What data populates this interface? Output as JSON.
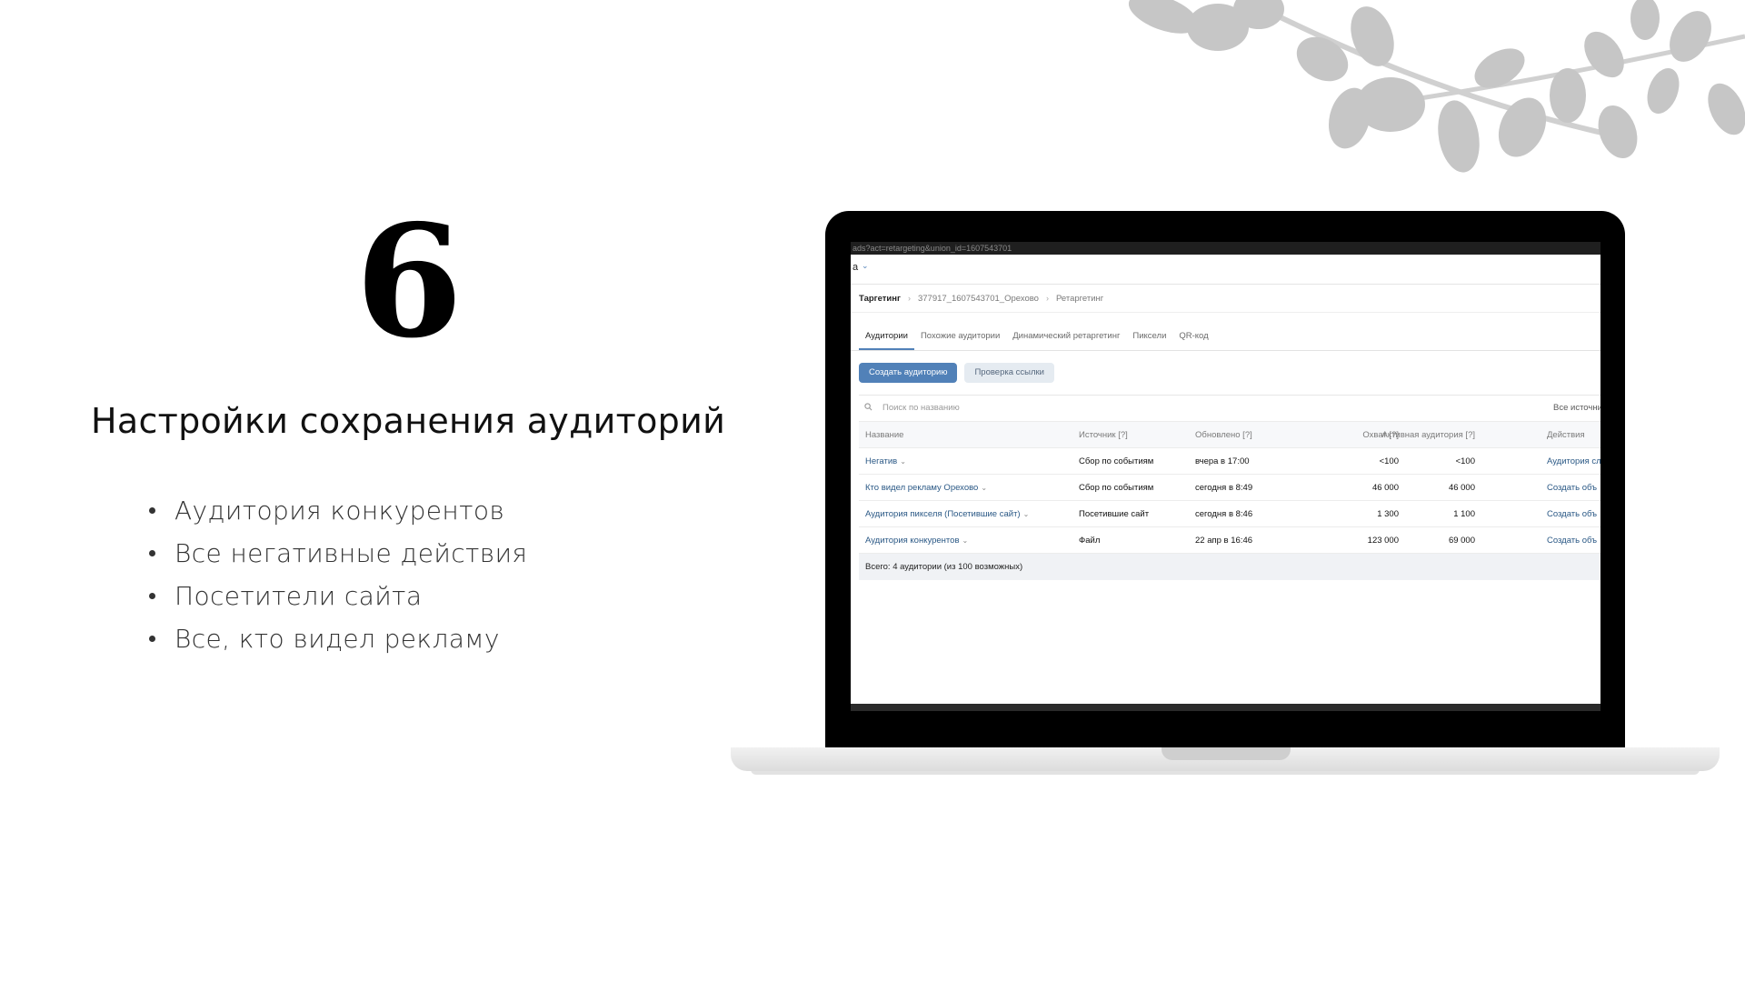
{
  "slide": {
    "number": "6",
    "title": "Настройки сохранения аудиторий",
    "bullets": [
      "Аудитория конкурентов",
      "Все негативные действия",
      "Посетители сайта",
      "Все, кто видел рекламу"
    ]
  },
  "screen": {
    "url": "ads?act=retargeting&union_id=1607543701",
    "account_letter": "а",
    "breadcrumb": [
      "Таргетинг",
      "377917_1607543701_Орехово",
      "Ретаргетинг"
    ],
    "tabs": [
      {
        "label": "Аудитории",
        "active": true
      },
      {
        "label": "Похожие аудитории",
        "active": false
      },
      {
        "label": "Динамический ретаргетинг",
        "active": false
      },
      {
        "label": "Пиксели",
        "active": false
      },
      {
        "label": "QR-код",
        "active": false
      }
    ],
    "buttons": {
      "create_audience": "Создать аудиторию",
      "check_link": "Проверка ссылки"
    },
    "search": {
      "placeholder": "Поиск по названию",
      "filter_label": "Все источники"
    },
    "table": {
      "columns": {
        "name": "Название",
        "source": "Источник [?]",
        "updated": "Обновлено [?]",
        "reach": "Охват [?]",
        "active": "Активная аудитория [?]",
        "actions": "Действия"
      },
      "rows": [
        {
          "name": "Негатив",
          "source": "Сбор по событиям",
          "updated": "вчера в 17:00",
          "reach": "<100",
          "active": "<100",
          "action": "Аудитория сл"
        },
        {
          "name": "Кто видел рекламу Орехово",
          "source": "Сбор по событиям",
          "updated": "сегодня в 8:49",
          "reach": "46 000",
          "active": "46 000",
          "action": "Создать объ"
        },
        {
          "name": "Аудитория пикселя (Посетившие сайт)",
          "source": "Посетившие сайт",
          "updated": "сегодня в 8:46",
          "reach": "1 300",
          "active": "1 100",
          "action": "Создать объ"
        },
        {
          "name": "Аудитория конкурентов",
          "source": "Файл",
          "updated": "22 апр в 16:46",
          "reach": "123 000",
          "active": "69 000",
          "action": "Создать объ"
        }
      ],
      "total": "Всего: 4 аудитории (из 100 возможных)"
    }
  },
  "colors": {
    "accent": "#5181b8",
    "link": "#2a5885",
    "leaves": "#c4c4c4"
  }
}
